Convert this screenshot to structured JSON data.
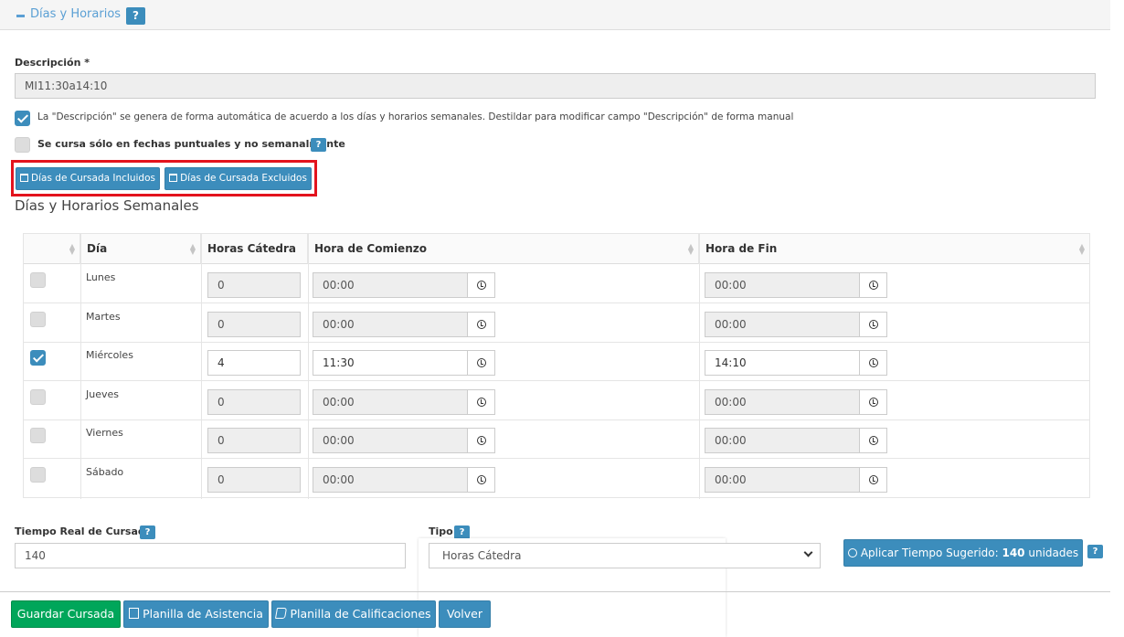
{
  "section": {
    "title": "Días y Horarios",
    "help": "?"
  },
  "descripcion": {
    "label": "Descripción *",
    "value": "MI11:30a14:10"
  },
  "auto_checkbox": {
    "checked": true,
    "text": "La \"Descripción\" se genera de forma automática de acuerdo a los días y horarios semanales. Destildar para modificar campo \"Descripción\" de forma manual"
  },
  "puntual_checkbox": {
    "checked": false,
    "text": "Se cursa sólo en fechas puntuales y no semanalmente",
    "help": "?"
  },
  "buttons": {
    "incluidos": "Días de Cursada Incluidos",
    "excluidos": "Días de Cursada Excluidos"
  },
  "subtitle": "Días y Horarios Semanales",
  "table": {
    "headers": {
      "dia": "Día",
      "horas": "Horas Cátedra",
      "comienzo": "Hora de Comienzo",
      "fin": "Hora de Fin"
    },
    "rows": [
      {
        "checked": false,
        "day": "Lunes",
        "horas": "0",
        "start": "00:00",
        "end": "00:00"
      },
      {
        "checked": false,
        "day": "Martes",
        "horas": "0",
        "start": "00:00",
        "end": "00:00"
      },
      {
        "checked": true,
        "day": "Miércoles",
        "horas": "4",
        "start": "11:30",
        "end": "14:10"
      },
      {
        "checked": false,
        "day": "Jueves",
        "horas": "0",
        "start": "00:00",
        "end": "00:00"
      },
      {
        "checked": false,
        "day": "Viernes",
        "horas": "0",
        "start": "00:00",
        "end": "00:00"
      },
      {
        "checked": false,
        "day": "Sábado",
        "horas": "0",
        "start": "00:00",
        "end": "00:00"
      }
    ]
  },
  "tiempo": {
    "label": "Tiempo Real de Cursada",
    "help": "?",
    "value": "140"
  },
  "tipo": {
    "label": "Tipo",
    "help": "?",
    "value": "Horas Cátedra"
  },
  "aplicar": {
    "prefix": "Aplicar Tiempo Sugerido: ",
    "amount": "140",
    "suffix": " unidades",
    "help": "?"
  },
  "footer": {
    "guardar": "Guardar Cursada",
    "asistencia": "Planilla de Asistencia",
    "calificaciones": "Planilla de Calificaciones",
    "volver": "Volver"
  },
  "colors": {
    "primary": "#3c8dbc",
    "success": "#00a65a",
    "highlight": "#e3131d"
  }
}
